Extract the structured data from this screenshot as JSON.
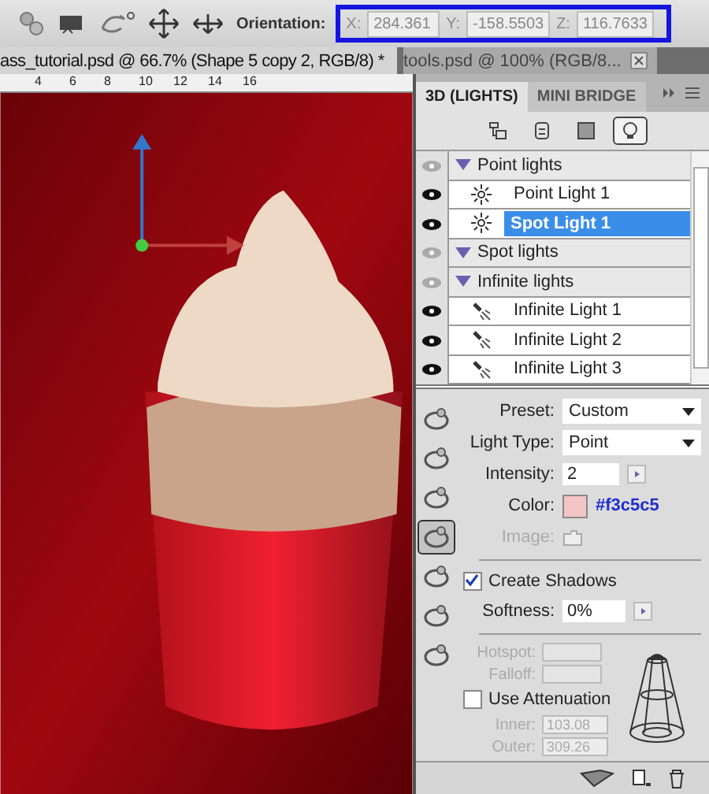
{
  "toolbar": {
    "orientation_label": "Orientation:",
    "fields": [
      {
        "label": "X:",
        "value": "284.361"
      },
      {
        "label": "Y:",
        "value": "-158.5503"
      },
      {
        "label": "Z:",
        "value": "116.7633"
      }
    ]
  },
  "doc_tabs": [
    {
      "title": "ass_tutorial.psd @ 66.7% (Shape 5 copy 2, RGB/8) *",
      "selected": true
    },
    {
      "title": "tools.psd @ 100% (RGB/8...",
      "selected": false
    }
  ],
  "ruler": [
    "4",
    "6",
    "8",
    "10",
    "12",
    "14",
    "16"
  ],
  "panel_tabs": [
    {
      "label": "3D (LIGHTS)",
      "selected": true
    },
    {
      "label": "MINI BRIDGE",
      "selected": false
    }
  ],
  "filters": [
    {
      "kind": "scene",
      "selected": false
    },
    {
      "kind": "mesh",
      "selected": false
    },
    {
      "kind": "material",
      "selected": false
    },
    {
      "kind": "light",
      "selected": true
    }
  ],
  "lights": [
    {
      "label": "Point lights",
      "visible": false,
      "children": [
        {
          "label": "Point Light 1",
          "kind": "point",
          "visible": true,
          "selected": false
        },
        {
          "label": "Spot Light 1",
          "kind": "point",
          "visible": true,
          "selected": true
        }
      ]
    },
    {
      "label": "Spot lights",
      "visible": false
    },
    {
      "label": "Infinite lights",
      "visible": false,
      "children": [
        {
          "label": "Infinite Light 1",
          "kind": "infinite",
          "visible": true,
          "selected": false
        },
        {
          "label": "Infinite Light 2",
          "kind": "infinite",
          "visible": true,
          "selected": false
        },
        {
          "label": "Infinite Light 3",
          "kind": "infinite",
          "visible": true,
          "selected": false
        }
      ]
    }
  ],
  "tools": [
    {
      "selected": false
    },
    {
      "selected": false
    },
    {
      "selected": false
    },
    {
      "selected": true
    },
    {
      "selected": false
    },
    {
      "selected": false
    },
    {
      "selected": false
    }
  ],
  "properties": {
    "preset_label": "Preset:",
    "preset": "Custom",
    "type_label": "Light Type:",
    "light_type": "Point",
    "intensity_label": "Intensity:",
    "intensity": "2",
    "color_label": "Color:",
    "color": "#f3c5c5",
    "color_text": "#f3c5c5",
    "image_label": "Image:",
    "image_disabled": true,
    "shadows_label": "Create Shadows",
    "create_shadows": true,
    "softness_label": "Softness:",
    "softness": "0%",
    "hotspot_label": "Hotspot:",
    "falloff_label": "Falloff:",
    "cone_disabled": true,
    "attenuation_label": "Use Attenuation",
    "use_attenuation": false,
    "inner_label": "Inner:",
    "inner": "103.08",
    "outer_label": "Outer:",
    "outer": "309.26"
  }
}
